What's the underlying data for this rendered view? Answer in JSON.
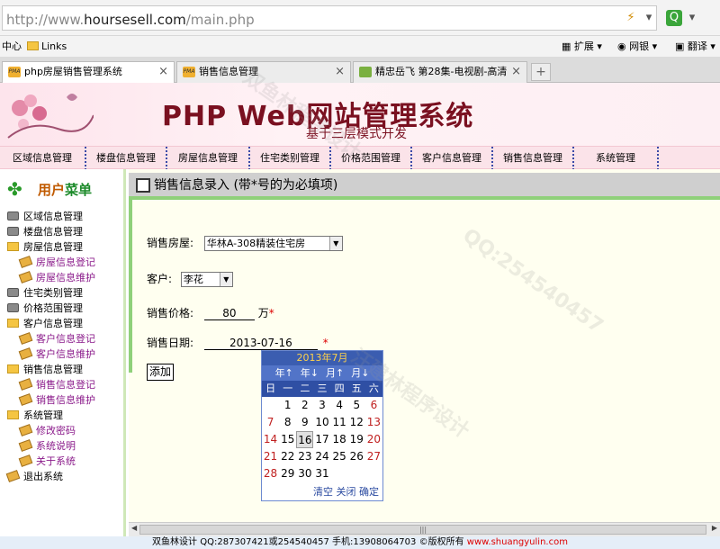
{
  "browser": {
    "url_prefix": "http://www.",
    "url_host": "hoursesell.com",
    "url_path": "/main.php",
    "bookmarks": {
      "center": "中心",
      "links": "Links"
    },
    "toolbar": {
      "extend": "扩展",
      "netbank": "网银",
      "translate": "翻译"
    },
    "tabs": [
      {
        "label": "php房屋销售管理系统",
        "active": true
      },
      {
        "label": "销售信息管理",
        "active": false
      },
      {
        "label": "精忠岳飞 第28集-电视剧-高清",
        "active": false
      }
    ]
  },
  "banner": {
    "title": "PHP Web网站管理系统",
    "subtitle": "基于三层模式开发"
  },
  "nav": [
    "区域信息管理",
    "楼盘信息管理",
    "房屋信息管理",
    "住宅类别管理",
    "价格范围管理",
    "客户信息管理",
    "销售信息管理",
    "系统管理"
  ],
  "sidebar": {
    "head_a": "用户",
    "head_b": "菜单",
    "tree": [
      {
        "label": "区域信息管理",
        "icon": "database-icon",
        "level": 0
      },
      {
        "label": "楼盘信息管理",
        "icon": "database-icon",
        "level": 0
      },
      {
        "label": "房屋信息管理",
        "icon": "folder-icon",
        "level": 0
      },
      {
        "label": "房屋信息登记",
        "icon": "page-icon",
        "level": 1
      },
      {
        "label": "房屋信息维护",
        "icon": "page-icon",
        "level": 1
      },
      {
        "label": "住宅类别管理",
        "icon": "database-icon",
        "level": 0
      },
      {
        "label": "价格范围管理",
        "icon": "database-icon",
        "level": 0
      },
      {
        "label": "客户信息管理",
        "icon": "folder-icon",
        "level": 0
      },
      {
        "label": "客户信息登记",
        "icon": "page-icon",
        "level": 1
      },
      {
        "label": "客户信息维护",
        "icon": "page-icon",
        "level": 1
      },
      {
        "label": "销售信息管理",
        "icon": "folder-icon",
        "level": 0
      },
      {
        "label": "销售信息登记",
        "icon": "page-icon",
        "level": 1
      },
      {
        "label": "销售信息维护",
        "icon": "page-icon",
        "level": 1
      },
      {
        "label": "系统管理",
        "icon": "folder-icon",
        "level": 0
      },
      {
        "label": "修改密码",
        "icon": "page-icon",
        "level": 1
      },
      {
        "label": "系统说明",
        "icon": "page-icon",
        "level": 1
      },
      {
        "label": "关于系统",
        "icon": "page-icon",
        "level": 1
      },
      {
        "label": "退出系统",
        "icon": "page-icon",
        "level": 0
      }
    ]
  },
  "form": {
    "heading": "销售信息录入 (带*号的为必填项)",
    "house_label": "销售房屋:",
    "house_value": "华林A-308精装住宅房",
    "customer_label": "客户:",
    "customer_value": "李花",
    "price_label": "销售价格:",
    "price_value": "80",
    "price_unit": "万",
    "date_label": "销售日期:",
    "date_value": "2013-07-16",
    "required_mark": "*",
    "submit": "添加"
  },
  "calendar": {
    "month_title": "2013年7月",
    "nav": [
      "年↑",
      "年↓",
      "月↑",
      "月↓"
    ],
    "weekdays": [
      "日",
      "一",
      "二",
      "三",
      "四",
      "五",
      "六"
    ],
    "leading_blanks": 1,
    "days": [
      "1",
      "2",
      "3",
      "4",
      "5",
      "6",
      "7",
      "8",
      "9",
      "10",
      "11",
      "12",
      "13",
      "14",
      "15",
      "16",
      "17",
      "18",
      "19",
      "20",
      "21",
      "22",
      "23",
      "24",
      "25",
      "26",
      "27",
      "28",
      "29",
      "30",
      "31"
    ],
    "selected_day": "16",
    "actions": [
      "清空",
      "关闭",
      "确定"
    ]
  },
  "footer": {
    "text": "双鱼林设计 QQ:287307421或254540457 手机:13908064703 ©版权所有",
    "link": "www.shuangyulin.com"
  },
  "watermarks": [
    "双鱼林程序设计",
    "QQ:254540457",
    "汪建林程序设计"
  ]
}
